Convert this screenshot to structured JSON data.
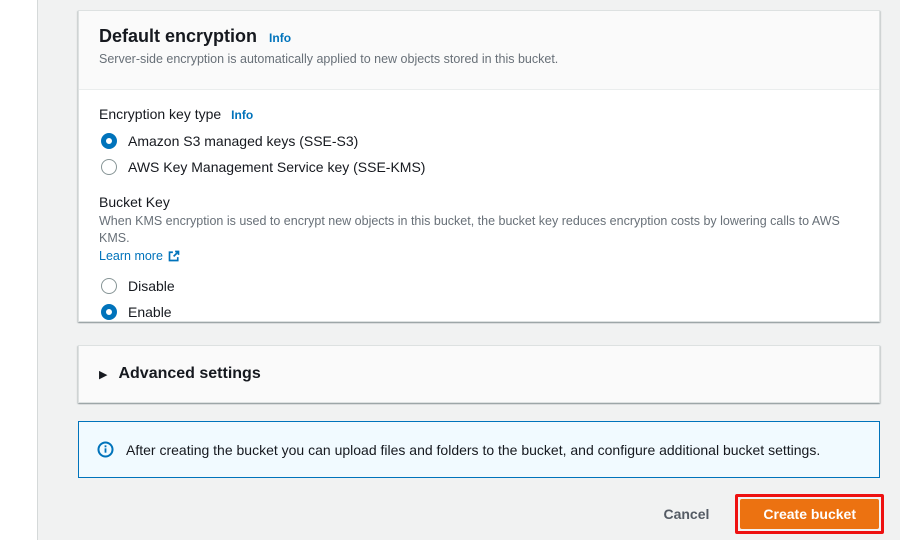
{
  "colors": {
    "link_blue": "#0073bb",
    "radio_selected_blue": "#0073bb",
    "button_orange": "#ec7211",
    "annotation_red": "#ee1111",
    "alert_bg": "#f1faff",
    "alert_border": "#0073bb",
    "content_bg": "#f1f2f2"
  },
  "default_encryption": {
    "title": "Default encryption",
    "title_info_label": "Info",
    "subtitle": "Server-side encryption is automatically applied to new objects stored in this bucket.",
    "encryption_key_type": {
      "label": "Encryption key type",
      "info_label": "Info",
      "options": [
        {
          "label": "Amazon S3 managed keys (SSE-S3)",
          "selected": true
        },
        {
          "label": "AWS Key Management Service key (SSE-KMS)",
          "selected": false
        }
      ]
    },
    "bucket_key": {
      "label": "Bucket Key",
      "description": "When KMS encryption is used to encrypt new objects in this bucket, the bucket key reduces encryption costs by lowering calls to AWS KMS.",
      "learn_more_label": "Learn more",
      "options": [
        {
          "label": "Disable",
          "selected": false
        },
        {
          "label": "Enable",
          "selected": true
        }
      ]
    }
  },
  "advanced_settings": {
    "title": "Advanced settings",
    "expand_icon": "▶"
  },
  "info_alert": {
    "text": "After creating the bucket you can upload files and folders to the bucket, and configure additional bucket settings."
  },
  "footer": {
    "cancel_label": "Cancel",
    "create_bucket_label": "Create bucket"
  }
}
